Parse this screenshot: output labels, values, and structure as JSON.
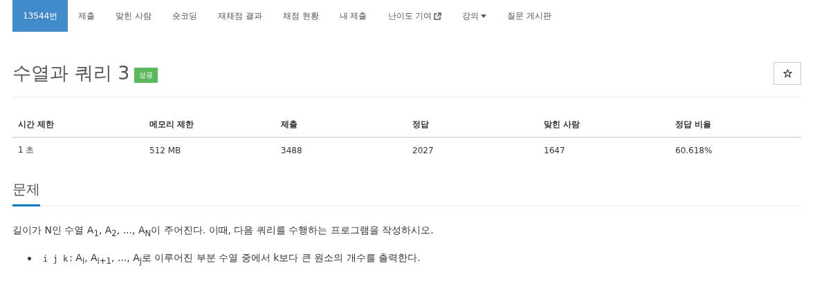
{
  "nav": [
    {
      "label": "13544번",
      "selected": true,
      "kind": "link"
    },
    {
      "label": "제출",
      "selected": false,
      "kind": "link"
    },
    {
      "label": "맞힌 사람",
      "selected": false,
      "kind": "link"
    },
    {
      "label": "숏코딩",
      "selected": false,
      "kind": "link"
    },
    {
      "label": "재채점 결과",
      "selected": false,
      "kind": "link"
    },
    {
      "label": "채점 현황",
      "selected": false,
      "kind": "link"
    },
    {
      "label": "내 제출",
      "selected": false,
      "kind": "link"
    },
    {
      "label": "난이도 기여",
      "selected": false,
      "kind": "external"
    },
    {
      "label": "강의",
      "selected": false,
      "kind": "dropdown"
    },
    {
      "label": "질문 게시판",
      "selected": false,
      "kind": "link"
    }
  ],
  "problem": {
    "title": "수열과 쿼리 3",
    "badge": "성공",
    "starred": false
  },
  "table": {
    "columns": [
      "시간 제한",
      "메모리 제한",
      "제출",
      "정답",
      "맞힌 사람",
      "정답 비율"
    ],
    "rows": [
      [
        "1 초",
        "512 MB",
        "3488",
        "2027",
        "1647",
        "60.618%"
      ]
    ]
  },
  "section": {
    "heading": "문제",
    "paragraph": "길이가 N인 수열 A$_{1}$, A$_{2}$, ..., A$_{N}$이 주어진다. 이때, 다음 쿼리를 수행하는 프로그램을 작성하시오.",
    "items": [
      {
        "code": "i j k",
        "text": ": A$_{i}$, A$_{i+1}$, ..., A$_{j}$로 이루어진 부분 수열 중에서 k보다 큰 원소의 개수를 출력한다."
      }
    ]
  }
}
